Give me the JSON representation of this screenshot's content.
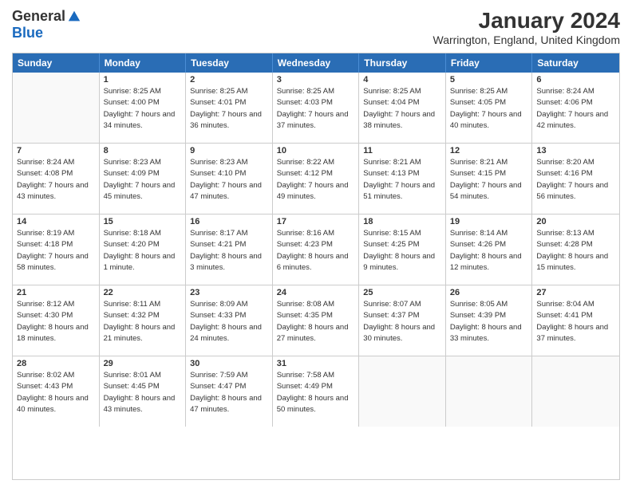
{
  "header": {
    "logo_general": "General",
    "logo_blue": "Blue",
    "month_title": "January 2024",
    "location": "Warrington, England, United Kingdom"
  },
  "calendar": {
    "days_of_week": [
      "Sunday",
      "Monday",
      "Tuesday",
      "Wednesday",
      "Thursday",
      "Friday",
      "Saturday"
    ],
    "rows": [
      [
        {
          "day": "",
          "empty": true
        },
        {
          "day": "1",
          "sunrise": "Sunrise: 8:25 AM",
          "sunset": "Sunset: 4:00 PM",
          "daylight": "Daylight: 7 hours and 34 minutes."
        },
        {
          "day": "2",
          "sunrise": "Sunrise: 8:25 AM",
          "sunset": "Sunset: 4:01 PM",
          "daylight": "Daylight: 7 hours and 36 minutes."
        },
        {
          "day": "3",
          "sunrise": "Sunrise: 8:25 AM",
          "sunset": "Sunset: 4:03 PM",
          "daylight": "Daylight: 7 hours and 37 minutes."
        },
        {
          "day": "4",
          "sunrise": "Sunrise: 8:25 AM",
          "sunset": "Sunset: 4:04 PM",
          "daylight": "Daylight: 7 hours and 38 minutes."
        },
        {
          "day": "5",
          "sunrise": "Sunrise: 8:25 AM",
          "sunset": "Sunset: 4:05 PM",
          "daylight": "Daylight: 7 hours and 40 minutes."
        },
        {
          "day": "6",
          "sunrise": "Sunrise: 8:24 AM",
          "sunset": "Sunset: 4:06 PM",
          "daylight": "Daylight: 7 hours and 42 minutes."
        }
      ],
      [
        {
          "day": "7",
          "sunrise": "Sunrise: 8:24 AM",
          "sunset": "Sunset: 4:08 PM",
          "daylight": "Daylight: 7 hours and 43 minutes."
        },
        {
          "day": "8",
          "sunrise": "Sunrise: 8:23 AM",
          "sunset": "Sunset: 4:09 PM",
          "daylight": "Daylight: 7 hours and 45 minutes."
        },
        {
          "day": "9",
          "sunrise": "Sunrise: 8:23 AM",
          "sunset": "Sunset: 4:10 PM",
          "daylight": "Daylight: 7 hours and 47 minutes."
        },
        {
          "day": "10",
          "sunrise": "Sunrise: 8:22 AM",
          "sunset": "Sunset: 4:12 PM",
          "daylight": "Daylight: 7 hours and 49 minutes."
        },
        {
          "day": "11",
          "sunrise": "Sunrise: 8:21 AM",
          "sunset": "Sunset: 4:13 PM",
          "daylight": "Daylight: 7 hours and 51 minutes."
        },
        {
          "day": "12",
          "sunrise": "Sunrise: 8:21 AM",
          "sunset": "Sunset: 4:15 PM",
          "daylight": "Daylight: 7 hours and 54 minutes."
        },
        {
          "day": "13",
          "sunrise": "Sunrise: 8:20 AM",
          "sunset": "Sunset: 4:16 PM",
          "daylight": "Daylight: 7 hours and 56 minutes."
        }
      ],
      [
        {
          "day": "14",
          "sunrise": "Sunrise: 8:19 AM",
          "sunset": "Sunset: 4:18 PM",
          "daylight": "Daylight: 7 hours and 58 minutes."
        },
        {
          "day": "15",
          "sunrise": "Sunrise: 8:18 AM",
          "sunset": "Sunset: 4:20 PM",
          "daylight": "Daylight: 8 hours and 1 minute."
        },
        {
          "day": "16",
          "sunrise": "Sunrise: 8:17 AM",
          "sunset": "Sunset: 4:21 PM",
          "daylight": "Daylight: 8 hours and 3 minutes."
        },
        {
          "day": "17",
          "sunrise": "Sunrise: 8:16 AM",
          "sunset": "Sunset: 4:23 PM",
          "daylight": "Daylight: 8 hours and 6 minutes."
        },
        {
          "day": "18",
          "sunrise": "Sunrise: 8:15 AM",
          "sunset": "Sunset: 4:25 PM",
          "daylight": "Daylight: 8 hours and 9 minutes."
        },
        {
          "day": "19",
          "sunrise": "Sunrise: 8:14 AM",
          "sunset": "Sunset: 4:26 PM",
          "daylight": "Daylight: 8 hours and 12 minutes."
        },
        {
          "day": "20",
          "sunrise": "Sunrise: 8:13 AM",
          "sunset": "Sunset: 4:28 PM",
          "daylight": "Daylight: 8 hours and 15 minutes."
        }
      ],
      [
        {
          "day": "21",
          "sunrise": "Sunrise: 8:12 AM",
          "sunset": "Sunset: 4:30 PM",
          "daylight": "Daylight: 8 hours and 18 minutes."
        },
        {
          "day": "22",
          "sunrise": "Sunrise: 8:11 AM",
          "sunset": "Sunset: 4:32 PM",
          "daylight": "Daylight: 8 hours and 21 minutes."
        },
        {
          "day": "23",
          "sunrise": "Sunrise: 8:09 AM",
          "sunset": "Sunset: 4:33 PM",
          "daylight": "Daylight: 8 hours and 24 minutes."
        },
        {
          "day": "24",
          "sunrise": "Sunrise: 8:08 AM",
          "sunset": "Sunset: 4:35 PM",
          "daylight": "Daylight: 8 hours and 27 minutes."
        },
        {
          "day": "25",
          "sunrise": "Sunrise: 8:07 AM",
          "sunset": "Sunset: 4:37 PM",
          "daylight": "Daylight: 8 hours and 30 minutes."
        },
        {
          "day": "26",
          "sunrise": "Sunrise: 8:05 AM",
          "sunset": "Sunset: 4:39 PM",
          "daylight": "Daylight: 8 hours and 33 minutes."
        },
        {
          "day": "27",
          "sunrise": "Sunrise: 8:04 AM",
          "sunset": "Sunset: 4:41 PM",
          "daylight": "Daylight: 8 hours and 37 minutes."
        }
      ],
      [
        {
          "day": "28",
          "sunrise": "Sunrise: 8:02 AM",
          "sunset": "Sunset: 4:43 PM",
          "daylight": "Daylight: 8 hours and 40 minutes."
        },
        {
          "day": "29",
          "sunrise": "Sunrise: 8:01 AM",
          "sunset": "Sunset: 4:45 PM",
          "daylight": "Daylight: 8 hours and 43 minutes."
        },
        {
          "day": "30",
          "sunrise": "Sunrise: 7:59 AM",
          "sunset": "Sunset: 4:47 PM",
          "daylight": "Daylight: 8 hours and 47 minutes."
        },
        {
          "day": "31",
          "sunrise": "Sunrise: 7:58 AM",
          "sunset": "Sunset: 4:49 PM",
          "daylight": "Daylight: 8 hours and 50 minutes."
        },
        {
          "day": "",
          "empty": true
        },
        {
          "day": "",
          "empty": true
        },
        {
          "day": "",
          "empty": true
        }
      ]
    ]
  }
}
